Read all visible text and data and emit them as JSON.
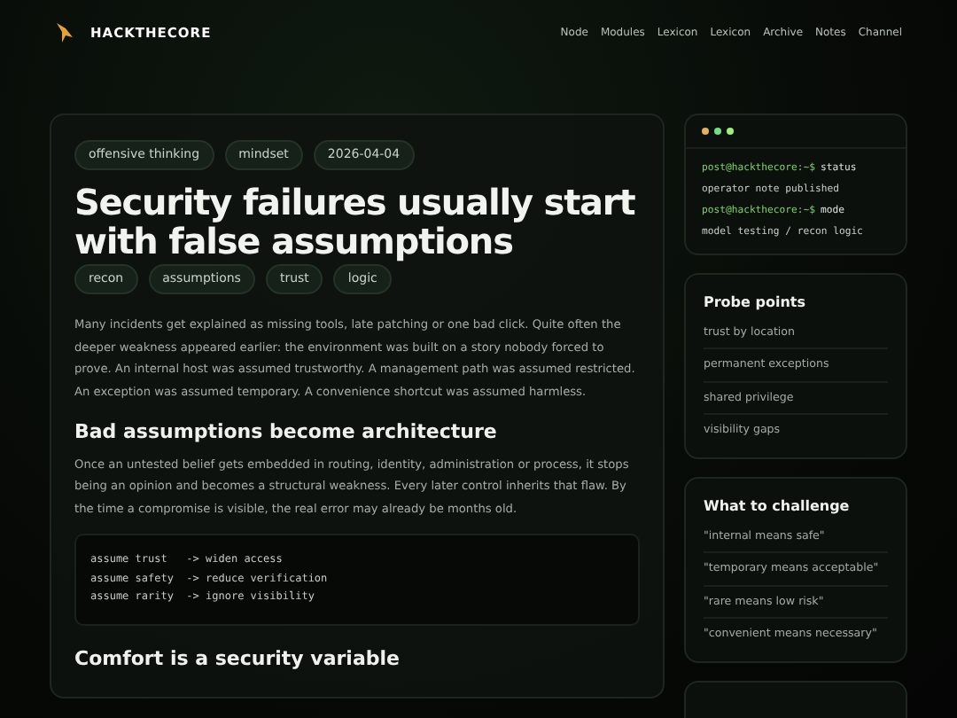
{
  "brand": {
    "name": "HACKTHECORE"
  },
  "nav": [
    "Node",
    "Modules",
    "Lexicon",
    "Lexicon",
    "Archive",
    "Notes",
    "Channel"
  ],
  "article": {
    "meta_tags": [
      "offensive thinking",
      "mindset",
      "2026-04-04"
    ],
    "title": "Security failures usually start with false assumptions",
    "tags": [
      "recon",
      "assumptions",
      "trust",
      "logic"
    ],
    "intro": "Many incidents get explained as missing tools, late patching or one bad click. Quite often the deeper weakness appeared earlier: the environment was built on a story nobody forced to prove. An internal host was assumed trustworthy. A management path was assumed restricted. An exception was assumed temporary. A convenience shortcut was assumed harmless.",
    "sections": [
      {
        "heading": "Bad assumptions become architecture",
        "body": "Once an untested belief gets embedded in routing, identity, administration or process, it stops being an opinion and becomes a structural weakness. Every later control inherits that flaw. By the time a compromise is visible, the real error may already be months old.",
        "code": [
          "assume trust   -> widen access",
          "assume safety  -> reduce verification",
          "assume rarity  -> ignore visibility"
        ]
      },
      {
        "heading": "Comfort is a security variable"
      }
    ]
  },
  "terminal": {
    "lines": [
      {
        "kind": "command",
        "prompt": "post@hackthecore:~$",
        "text": "status"
      },
      {
        "kind": "output",
        "text": "operator note published"
      },
      {
        "kind": "command",
        "prompt": "post@hackthecore:~$",
        "text": "mode"
      },
      {
        "kind": "output",
        "text": "model testing / recon logic"
      }
    ]
  },
  "cards": [
    {
      "title": "Probe points",
      "items": [
        "trust by location",
        "permanent exceptions",
        "shared privilege",
        "visibility gaps"
      ]
    },
    {
      "title": "What to challenge",
      "items": [
        "\"internal means safe\"",
        "\"temporary means acceptable\"",
        "\"rare means low risk\"",
        "\"convenient means necessary\""
      ]
    }
  ]
}
